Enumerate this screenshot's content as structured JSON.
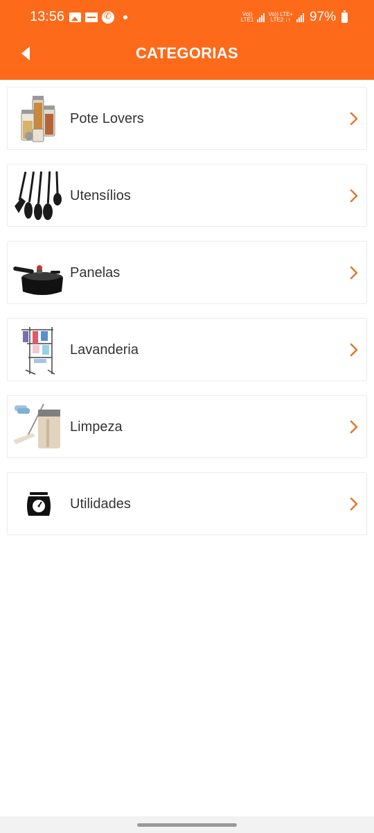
{
  "status_bar": {
    "time": "13:56",
    "network_1": "Vo)) LTE1",
    "network_2": "Vo)) LTE+ LTE2",
    "battery_percent": "97%"
  },
  "header": {
    "title": "CATEGORIAS",
    "background_color": "#fd6a1a"
  },
  "categories": [
    {
      "label": "Pote Lovers",
      "icon": "jars-image"
    },
    {
      "label": "Utensílios",
      "icon": "kitchen-utensils-image"
    },
    {
      "label": "Panelas",
      "icon": "pressure-cooker-image"
    },
    {
      "label": "Lavanderia",
      "icon": "clothes-rack-image"
    },
    {
      "label": "Limpeza",
      "icon": "mop-bucket-image"
    },
    {
      "label": "Utilidades",
      "icon": "kitchen-scale-icon"
    }
  ],
  "accent_color": "#e8742a"
}
